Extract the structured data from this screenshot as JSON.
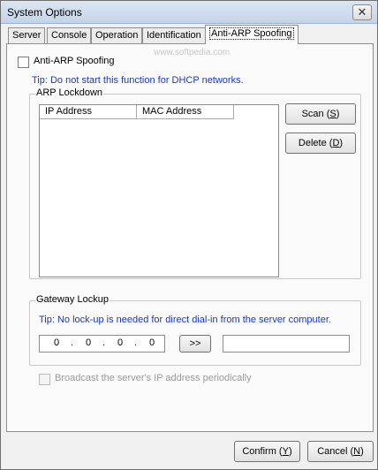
{
  "window": {
    "title": "System Options",
    "close_glyph": "✕"
  },
  "tabs": [
    {
      "label": "Server"
    },
    {
      "label": "Console"
    },
    {
      "label": "Operation"
    },
    {
      "label": "Identification"
    },
    {
      "label": "Anti-ARP Spoofing",
      "active": true
    }
  ],
  "anti_arp": {
    "checkbox_label": "Anti-ARP Spoofing",
    "checked": false,
    "tip": "Tip: Do not start this function for DHCP networks."
  },
  "watermark": "www.softpedia.com",
  "arp_lockdown": {
    "legend": "ARP Lockdown",
    "columns": [
      "IP Address",
      "MAC Address"
    ],
    "rows": [],
    "scan_label": "Scan",
    "scan_key": "S",
    "delete_label": "Delete",
    "delete_key": "D"
  },
  "gateway_lockup": {
    "legend": "Gateway Lockup",
    "tip": "Tip: No lock-up is needed for direct dial-in from the server computer.",
    "ip_octets": [
      "0",
      "0",
      "0",
      "0"
    ],
    "ip_dot": ".",
    "arrow_label": ">>",
    "mac_value": ""
  },
  "broadcast": {
    "label": "Broadcast the server's IP address periodically",
    "checked": false,
    "enabled": false
  },
  "footer": {
    "confirm_label": "Confirm",
    "confirm_key": "Y",
    "cancel_label": "Cancel",
    "cancel_key": "N"
  }
}
